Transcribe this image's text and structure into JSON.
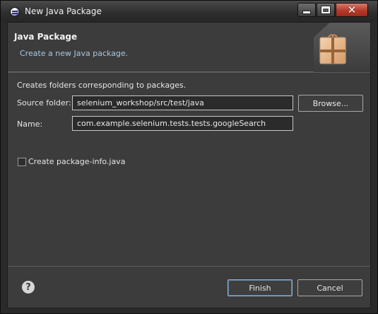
{
  "window": {
    "title": "New Java Package",
    "icon": "eclipse-icon",
    "controls": {
      "minimize": "minimize-icon",
      "maximize": "maximize-icon",
      "close": "close-icon"
    }
  },
  "banner": {
    "title": "Java Package",
    "subtitle": "Create a new Java package.",
    "image": "package-icon",
    "subtitle_color": "#a8c8e6"
  },
  "body": {
    "description": "Creates folders corresponding to packages.",
    "source_folder": {
      "label": "Source folder:",
      "value": "selenium_workshop/src/test/java",
      "browse_label": "Browse..."
    },
    "name": {
      "label": "Name:",
      "value": "com.example.selenium.tests.tests.googleSearch"
    },
    "checkbox": {
      "label": "Create package-info.java",
      "checked": false
    }
  },
  "footer": {
    "help": "?",
    "finish_label": "Finish",
    "cancel_label": "Cancel"
  }
}
